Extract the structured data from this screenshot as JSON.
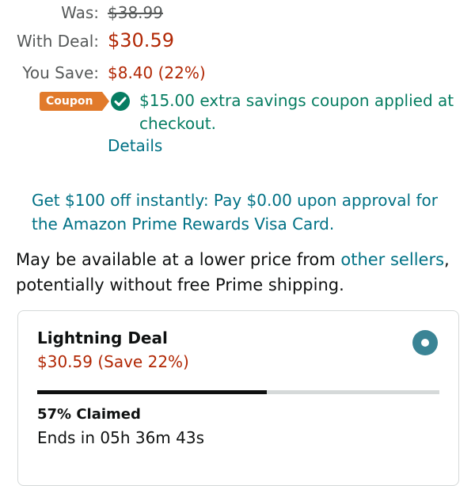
{
  "pricing": {
    "was_label": "Was:",
    "was_value": "$38.99",
    "deal_label": "With Deal:",
    "deal_value": "$30.59",
    "save_label": "You Save:",
    "save_value": "$8.40 (22%)"
  },
  "coupon": {
    "badge": "Coupon",
    "text": "$15.00 extra savings coupon applied at checkout.",
    "details": "Details"
  },
  "offer": {
    "text": "Get $100 off instantly: Pay $0.00 upon approval for the Amazon Prime Rewards Visa Card."
  },
  "lower_price": {
    "prefix": "May be available at a lower price from ",
    "link": "other sellers",
    "suffix": ", potentially without free Prime shipping."
  },
  "deal_card": {
    "title": "Lightning Deal",
    "price": "$30.59 (Save 22%)",
    "claimed_percent": 57,
    "claimed_label": "57% Claimed",
    "ends": "Ends in 05h 36m 43s"
  },
  "colors": {
    "price": "#b12704",
    "link": "#007185",
    "coupon_green": "#067d62",
    "coupon_badge": "#e17a2b",
    "radio": "#3a8495"
  }
}
